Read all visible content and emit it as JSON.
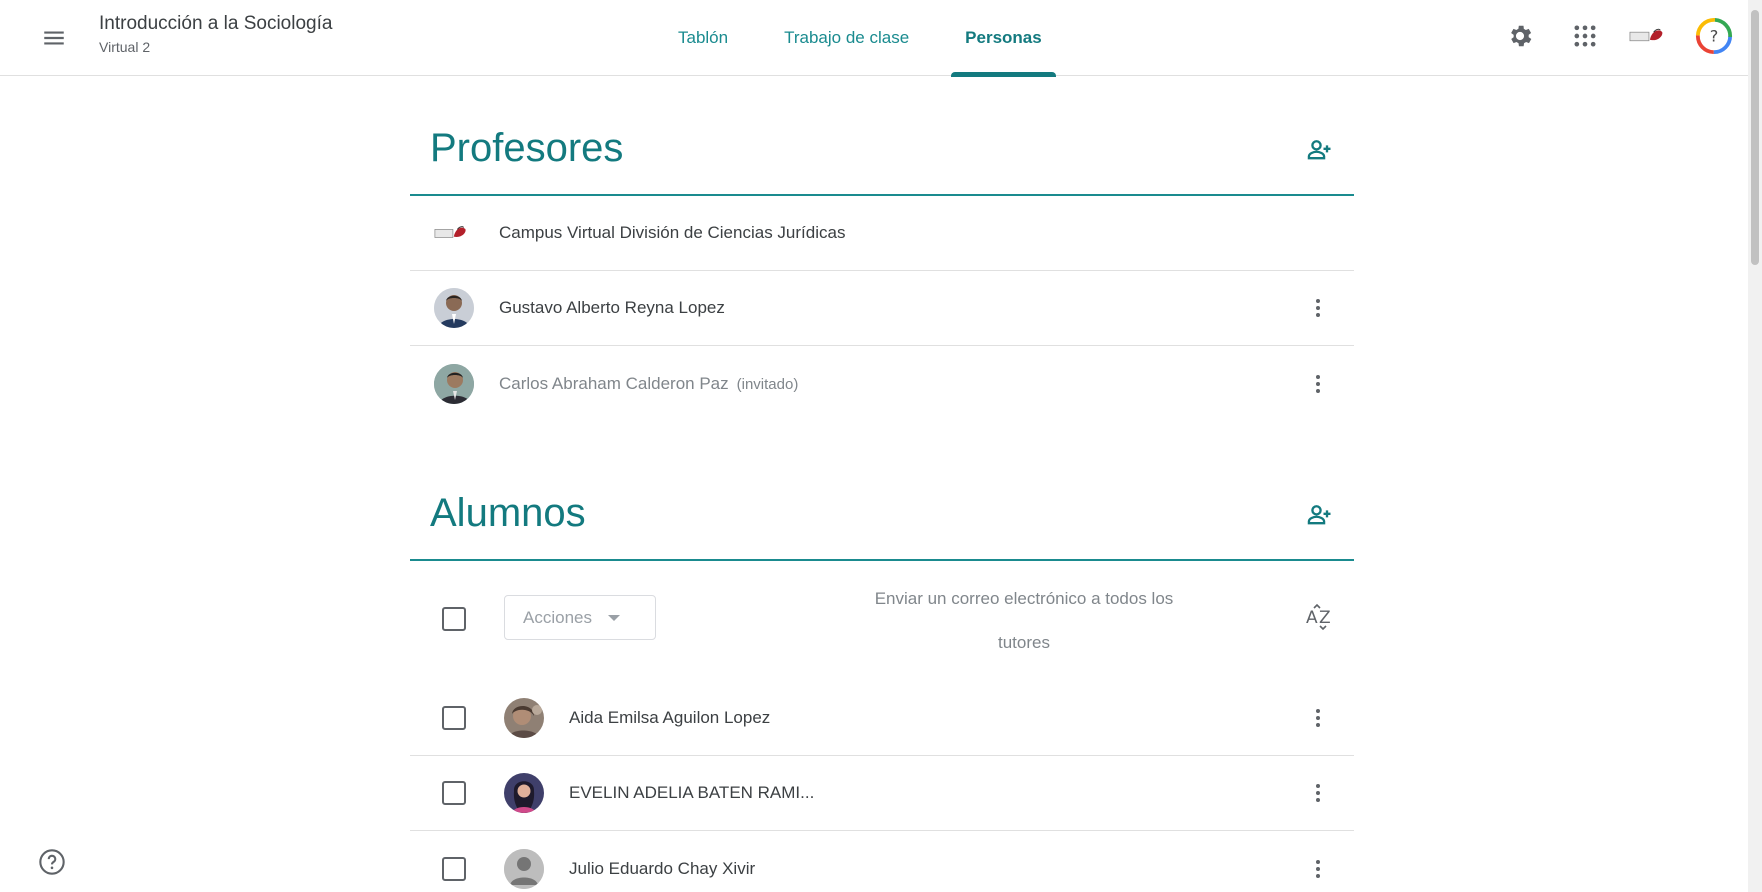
{
  "header": {
    "menu_icon": "hamburger-icon",
    "class_name": "Introducción a la Sociología",
    "class_section": "Virtual 2",
    "tabs": [
      {
        "label": "Tablón",
        "active": false
      },
      {
        "label": "Trabajo de clase",
        "active": false
      },
      {
        "label": "Personas",
        "active": true
      }
    ],
    "right_icons": [
      "gear-icon",
      "apps-grid-icon",
      "institution-logo",
      "account-avatar"
    ]
  },
  "teachers": {
    "title": "Profesores",
    "add_icon": "person-add-icon",
    "people": [
      {
        "name": "Campus Virtual División de Ciencias Jurídicas",
        "avatar": "institution-logo",
        "invited": false,
        "has_menu": false
      },
      {
        "name": "Gustavo Alberto Reyna Lopez",
        "avatar": "photo",
        "invited": false,
        "has_menu": true
      },
      {
        "name": "Carlos Abraham Calderon Paz",
        "invited_label": "(invitado)",
        "avatar": "photo",
        "invited": true,
        "has_menu": true
      }
    ]
  },
  "students": {
    "title": "Alumnos",
    "add_icon": "person-add-icon",
    "toolbar": {
      "actions_label": "Acciones",
      "email_guardians": "Enviar un correo electrónico a todos los tutores",
      "sort_icon": "sort-az-icon"
    },
    "people": [
      {
        "name": "Aida Emilsa Aguilon Lopez",
        "avatar": "photo"
      },
      {
        "name": "EVELIN ADELIA BATEN RAMI...",
        "avatar": "photo"
      },
      {
        "name": "Julio Eduardo Chay Xivir",
        "avatar": "default"
      }
    ]
  },
  "colors": {
    "accent": "#137a7f",
    "tab_link": "#1a8b8f",
    "text": "#3c4043",
    "muted": "#80868b",
    "divider": "#e0e0e0"
  }
}
